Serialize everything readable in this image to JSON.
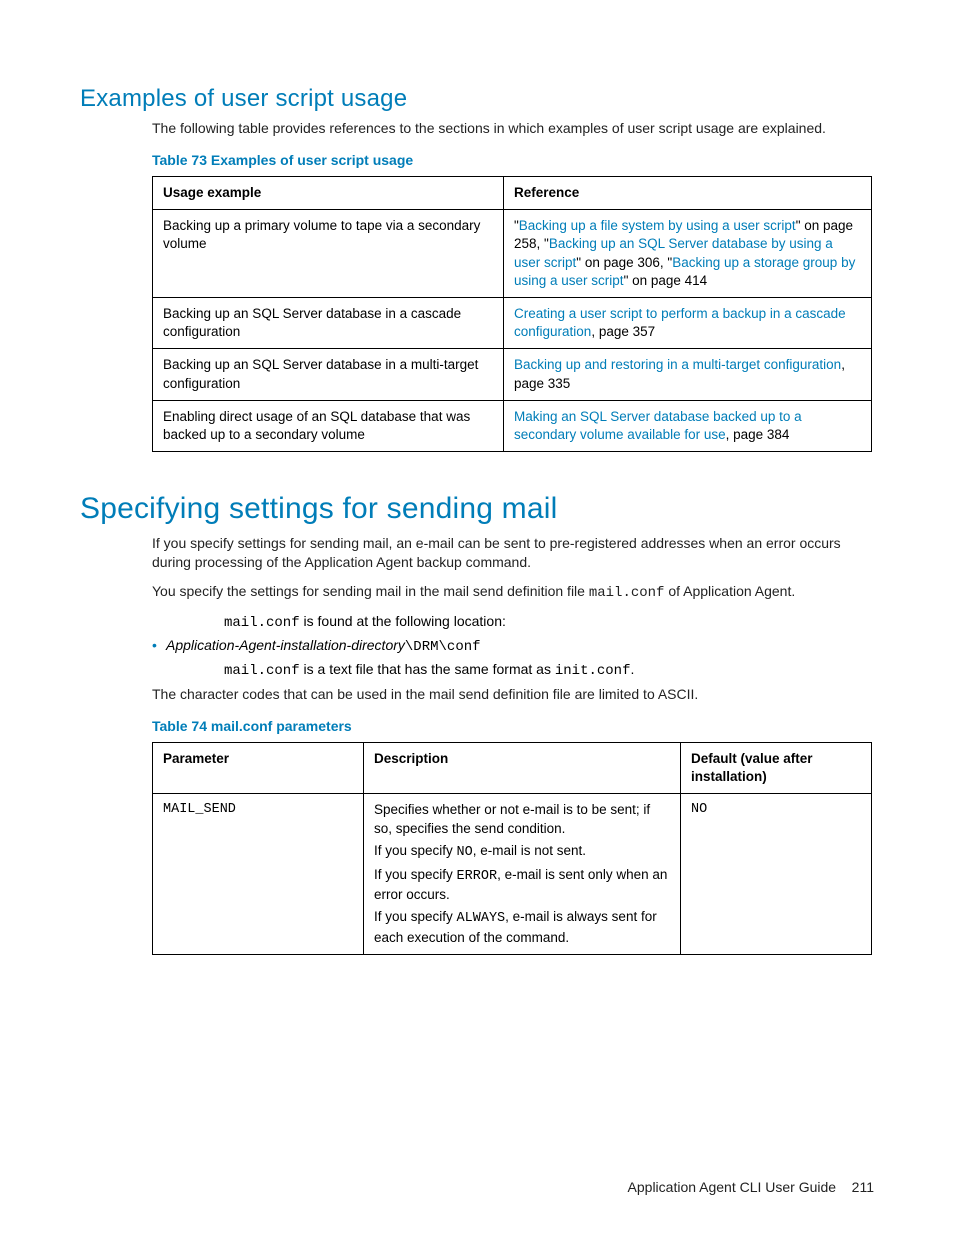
{
  "section1": {
    "heading": "Examples of user script usage",
    "intro": "The following table provides references to the sections in which examples of user script usage are explained.",
    "tableCaption": "Table 73 Examples of user script usage",
    "headers": {
      "col1": "Usage example",
      "col2": "Reference"
    },
    "rows": [
      {
        "usage": "Backing up a primary volume to tape via a secondary volume",
        "ref_parts": {
          "q1": "\"",
          "l1": "Backing up a file system by using a user script",
          "t1": "\" on page 258, \"",
          "l2": "Backing up an SQL Server database by using a user script",
          "t2": "\" on page 306, \"",
          "l3": "Backing up a storage group by using a user script",
          "t3": "\" on page 414"
        }
      },
      {
        "usage": "Backing up an SQL Server database in a cascade configuration",
        "ref_parts": {
          "l1": "Creating a user script to perform a backup in a cascade configuration",
          "t1": ", page 357"
        }
      },
      {
        "usage": "Backing up an SQL Server database in a multi-target configuration",
        "ref_parts": {
          "l1": "Backing up and restoring in a multi-target configuration",
          "t1": ", page 335"
        }
      },
      {
        "usage": "Enabling direct usage of an SQL database that was backed up to a secondary volume",
        "ref_parts": {
          "l1": "Making an SQL Server database backed up to a secondary volume available for use",
          "t1": ", page 384"
        }
      }
    ]
  },
  "section2": {
    "heading": "Specifying settings for sending mail",
    "p1": "If you specify settings for sending mail, an e-mail can be sent to pre-registered addresses when an error occurs during processing of the Application Agent backup command.",
    "p2a": "You specify the settings for sending mail in the mail send definition file ",
    "p2b": "mail.conf",
    "p2c": " of Application Agent.",
    "p3a": "mail.conf",
    "p3b": " is found at the following location:",
    "bullet_italic": "Application-Agent-installation-directory",
    "bullet_mono": "\\DRM\\conf",
    "p4a": "mail.conf",
    "p4b": " is a text file that has the same format as ",
    "p4c": "init.conf",
    "p4d": ".",
    "p5": "The character codes that can be used in the mail send definition file are limited to ASCII.",
    "tableCaption": "Table 74 mail.conf parameters",
    "headers": {
      "col1": "Parameter",
      "col2": "Description",
      "col3": "Default (value after installation)"
    },
    "row1": {
      "param": "MAIL_SEND",
      "d1": "Specifies whether or not e-mail is to be sent; if so, specifies the send condition.",
      "d2a": "If you specify ",
      "d2b": "NO",
      "d2c": ", e-mail is not sent.",
      "d3a": "If you specify ",
      "d3b": "ERROR",
      "d3c": ", e-mail is sent only when an error occurs.",
      "d4a": "If you specify ",
      "d4b": "ALWAYS",
      "d4c": ", e-mail is always sent for each execution of the command.",
      "default": "NO"
    }
  },
  "footer": {
    "title": "Application Agent CLI User Guide",
    "page": "211"
  }
}
